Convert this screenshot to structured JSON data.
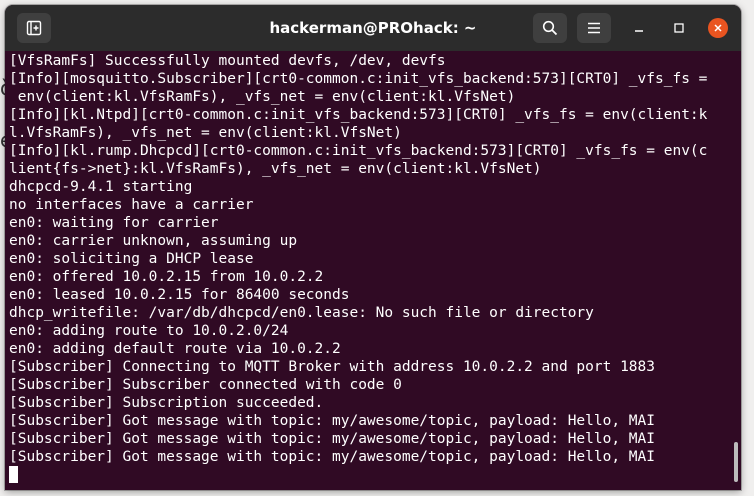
{
  "background": {
    "glyph_a": "ȍ",
    "glyph_b": "e"
  },
  "window": {
    "title": "hackerman@PROhack: ~",
    "title_color": "#ffffff",
    "terminal_bg": "#300a24",
    "titlebar_bg": "#2c2c2c",
    "close_color": "#e95420",
    "icons": {
      "new_tab": "new-tab-icon",
      "search": "search-icon",
      "menu": "hamburger-menu-icon",
      "minimize": "minimize-icon",
      "maximize": "maximize-icon",
      "close": "close-icon"
    }
  },
  "terminal": {
    "lines": [
      "[VfsRamFs] Successfully mounted devfs, /dev, devfs",
      "[Info][mosquitto.Subscriber][crt0-common.c:init_vfs_backend:573][CRT0] _vfs_fs =",
      " env(client:kl.VfsRamFs), _vfs_net = env(client:kl.VfsNet)",
      "[Info][kl.Ntpd][crt0-common.c:init_vfs_backend:573][CRT0] _vfs_fs = env(client:k",
      "l.VfsRamFs), _vfs_net = env(client:kl.VfsNet)",
      "[Info][kl.rump.Dhcpcd][crt0-common.c:init_vfs_backend:573][CRT0] _vfs_fs = env(c",
      "lient{fs->net}:kl.VfsRamFs), _vfs_net = env(client:kl.VfsNet)",
      "dhcpcd-9.4.1 starting",
      "no interfaces have a carrier",
      "en0: waiting for carrier",
      "en0: carrier unknown, assuming up",
      "en0: soliciting a DHCP lease",
      "en0: offered 10.0.2.15 from 10.0.2.2",
      "en0: leased 10.0.2.15 for 86400 seconds",
      "dhcp_writefile: /var/db/dhcpcd/en0.lease: No such file or directory",
      "en0: adding route to 10.0.2.0/24",
      "en0: adding default route via 10.0.2.2",
      "[Subscriber] Connecting to MQTT Broker with address 10.0.2.2 and port 1883",
      "[Subscriber] Subscriber connected with code 0",
      "[Subscriber] Subscription succeeded.",
      "[Subscriber] Got message with topic: my/awesome/topic, payload: Hello, MAI",
      "[Subscriber] Got message with topic: my/awesome/topic, payload: Hello, MAI",
      "[Subscriber] Got message with topic: my/awesome/topic, payload: Hello, MAI"
    ]
  }
}
